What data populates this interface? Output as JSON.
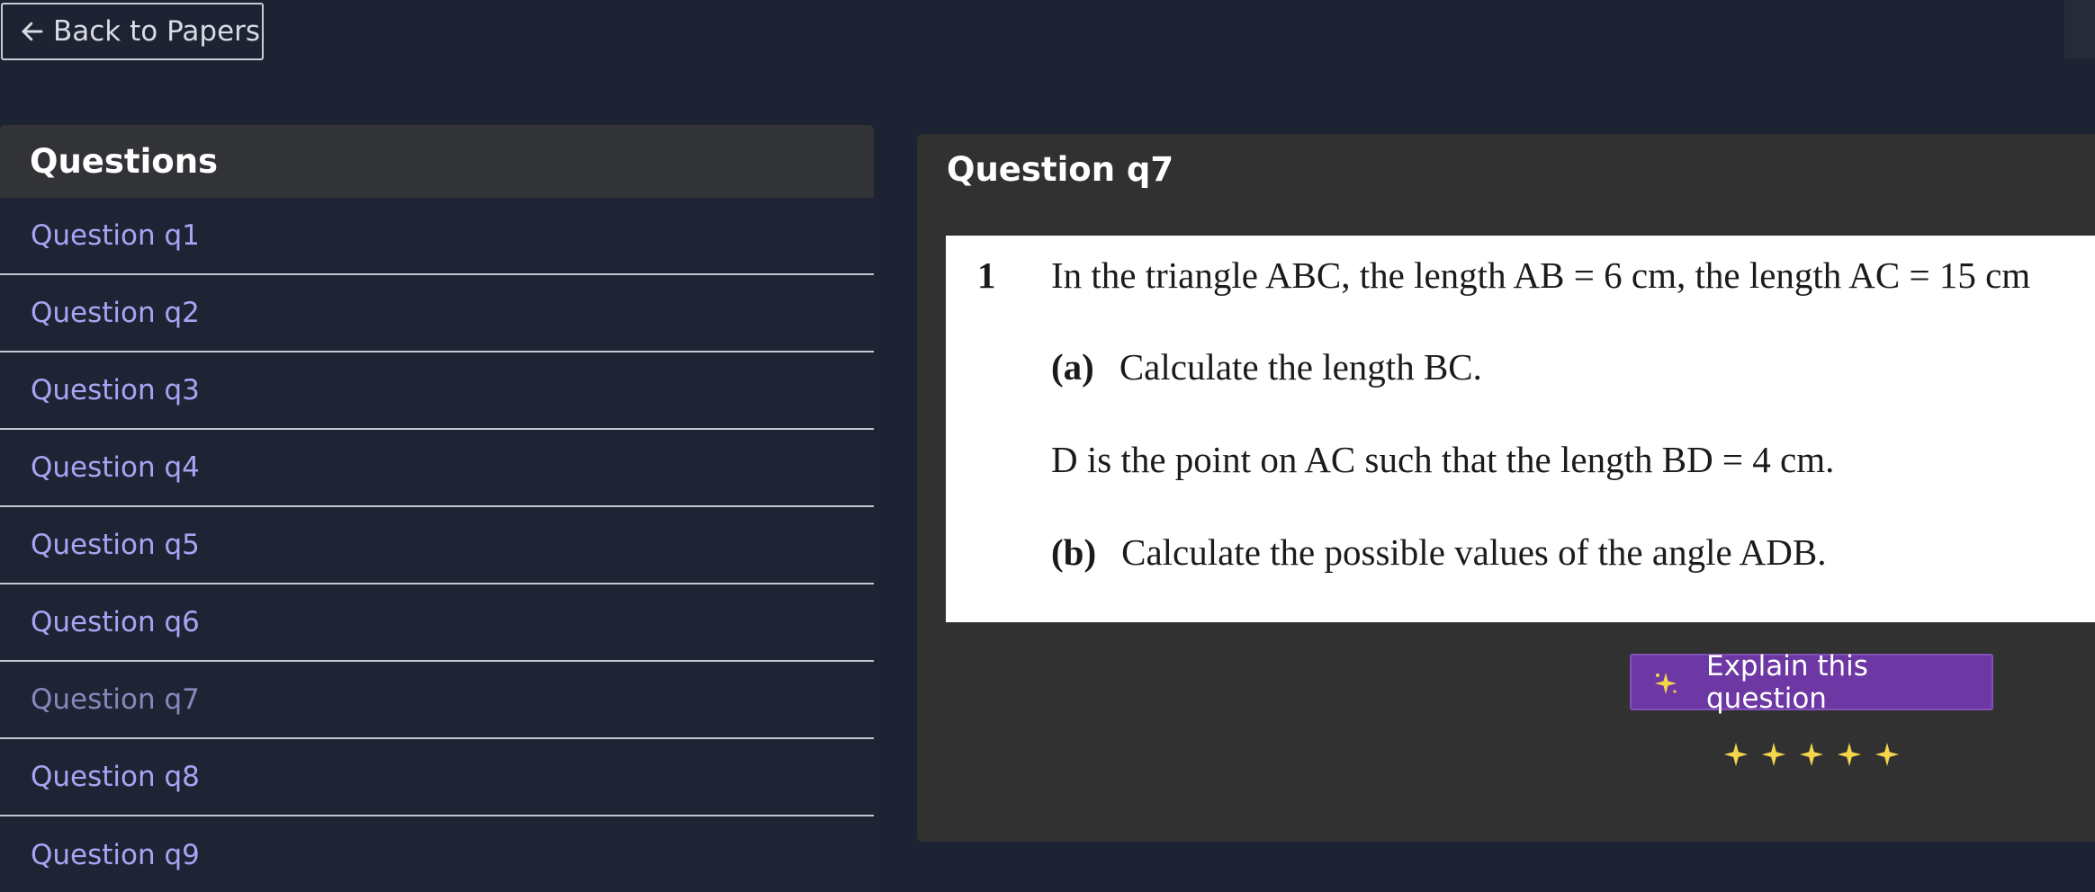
{
  "back_button": {
    "label": "Back to Papers"
  },
  "sidebar": {
    "title": "Questions",
    "items": [
      {
        "label": "Question q1"
      },
      {
        "label": "Question q2"
      },
      {
        "label": "Question q3"
      },
      {
        "label": "Question q4"
      },
      {
        "label": "Question q5"
      },
      {
        "label": "Question q6"
      },
      {
        "label": "Question q7",
        "active": true
      },
      {
        "label": "Question q8"
      },
      {
        "label": "Question q9"
      }
    ]
  },
  "main": {
    "title": "Question q7",
    "question": {
      "number": "1",
      "stem": "In the triangle ABC, the length AB = 6 cm, the length AC = 15 cm",
      "part_a_label": "(a)",
      "part_a_text": "Calculate the length BC.",
      "middle_text": "D is the point on AC such that the length BD = 4 cm.",
      "part_b_label": "(b)",
      "part_b_text": "Calculate the possible values of the angle ADB."
    },
    "explain_button": {
      "label": "Explain this question"
    },
    "rating": {
      "stars": 5
    }
  },
  "colors": {
    "background": "#1e2333",
    "link": "#a9a3f4",
    "active_link": "#8a86bb",
    "accent": "#6d38a3",
    "star": "#f4d64b"
  }
}
